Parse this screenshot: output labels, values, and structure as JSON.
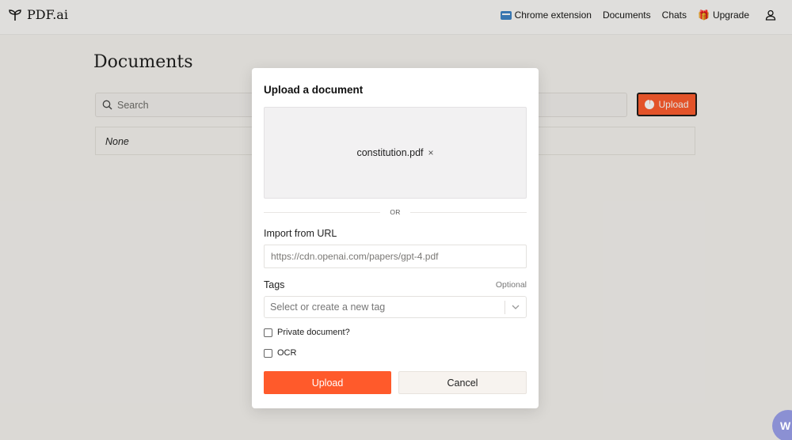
{
  "header": {
    "logo_text": "PDF.ai",
    "nav": {
      "chrome_extension": "Chrome extension",
      "documents": "Documents",
      "chats": "Chats",
      "upgrade": "Upgrade"
    }
  },
  "page": {
    "title": "Documents",
    "search_placeholder": "Search",
    "upload_button": "Upload",
    "table_empty": "None"
  },
  "modal": {
    "title": "Upload a document",
    "selected_file": "constitution.pdf",
    "remove_glyph": "×",
    "or_text": "OR",
    "url_label": "Import from URL",
    "url_placeholder": "https://cdn.openai.com/papers/gpt-4.pdf",
    "tags_label": "Tags",
    "tags_optional": "Optional",
    "tags_placeholder": "Select or create a new tag",
    "private_label": "Private document?",
    "private_checked": false,
    "ocr_label": "OCR",
    "ocr_checked": false,
    "upload_button": "Upload",
    "cancel_button": "Cancel"
  },
  "chat_widget_letter": "W",
  "colors": {
    "accent": "#ff5a2b",
    "background": "#f6f4f1",
    "modal_bg": "#ffffff",
    "chat_widget": "#8b90d3"
  }
}
